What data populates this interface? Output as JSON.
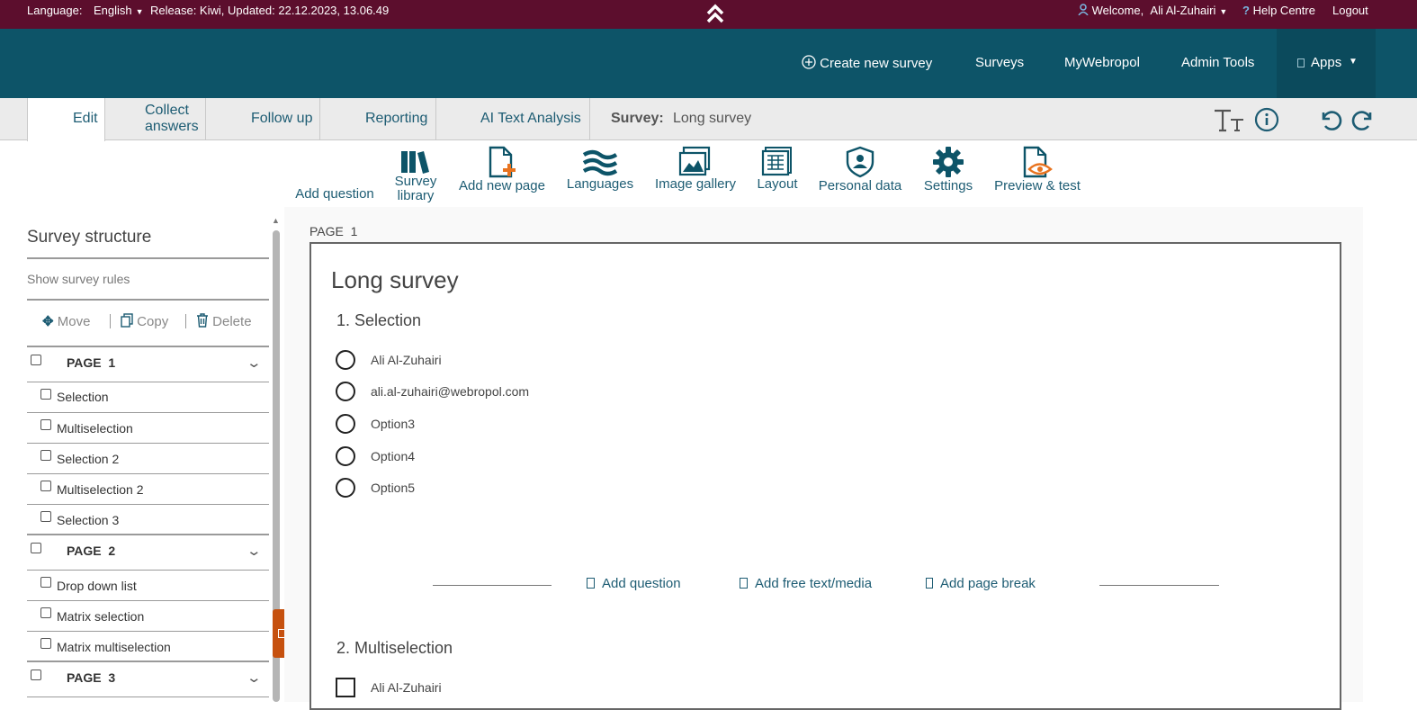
{
  "topbar": {
    "language_label": "Language:",
    "language_value": "English",
    "release": "Release: Kiwi, Updated: 22.12.2023, 13.06.49",
    "welcome": "Welcome,",
    "user": "Ali Al-Zuhairi",
    "help": "Help Centre",
    "logout": "Logout"
  },
  "navbar": {
    "create": "Create new survey",
    "surveys": "Surveys",
    "mywebropol": "MyWebropol",
    "admin": "Admin Tools",
    "apps": "Apps"
  },
  "tabs": {
    "edit": "Edit",
    "collect_1": "Collect",
    "collect_2": "answers",
    "follow": "Follow up",
    "reporting": "Reporting",
    "ai": "AI Text Analysis",
    "survey_label": "Survey:",
    "survey_name": "Long survey"
  },
  "toolbar": {
    "add_question": "Add question",
    "library_1": "Survey",
    "library_2": "library",
    "add_page": "Add new page",
    "languages": "Languages",
    "gallery": "Image gallery",
    "layout": "Layout",
    "personal": "Personal data",
    "settings": "Settings",
    "preview": "Preview & test"
  },
  "structure": {
    "title": "Survey structure",
    "show_rules": "Show survey rules",
    "move": "Move",
    "copy": "Copy",
    "delete": "Delete",
    "page1": "PAGE  1",
    "p1_items": [
      "Selection",
      "Multiselection",
      "Selection 2",
      "Multiselection 2",
      "Selection 3"
    ],
    "page2": "PAGE  2",
    "p2_items": [
      "Drop down list",
      "Matrix selection",
      "Matrix multiselection"
    ],
    "page3": "PAGE  3"
  },
  "editor": {
    "page_label": "PAGE  1",
    "survey_title": "Long survey",
    "q1_title": "1. Selection",
    "q1_options": [
      "Ali Al-Zuhairi",
      "ali.al-zuhairi@webropol.com",
      "Option3",
      "Option4",
      "Option5"
    ],
    "add_question": "Add question",
    "add_free_text": "Add free text/media",
    "add_page_break": "Add page break",
    "q2_title": "2. Multiselection",
    "q2_options": [
      "Ali Al-Zuhairi"
    ]
  },
  "colors": {
    "topbar": "#5c0e2d",
    "navbar": "#0d5468",
    "accent": "#1d5c73",
    "orange": "#e8731f"
  }
}
